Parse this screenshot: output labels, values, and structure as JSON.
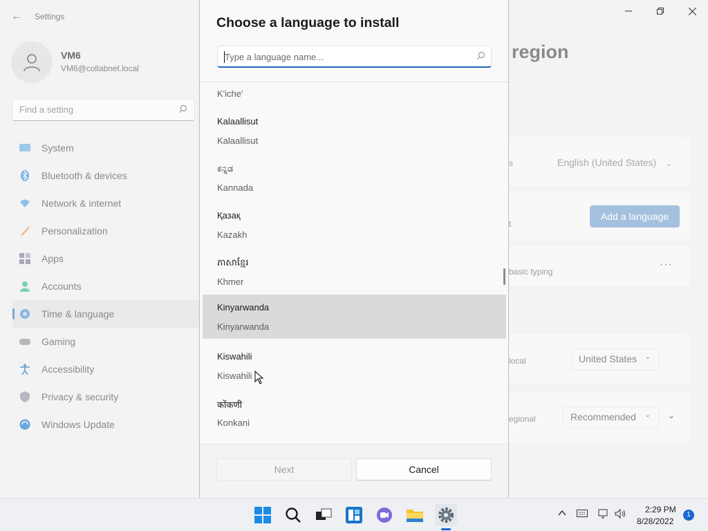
{
  "settings": {
    "title": "Settings",
    "profile": {
      "name": "VM6",
      "email": "VM6@collabnet.local"
    },
    "search_placeholder": "Find a setting",
    "nav": [
      {
        "label": "System",
        "icon": "system-icon"
      },
      {
        "label": "Bluetooth & devices",
        "icon": "bluetooth-icon"
      },
      {
        "label": "Network & internet",
        "icon": "network-icon"
      },
      {
        "label": "Personalization",
        "icon": "brush-icon"
      },
      {
        "label": "Apps",
        "icon": "apps-icon"
      },
      {
        "label": "Accounts",
        "icon": "accounts-icon"
      },
      {
        "label": "Time & language",
        "icon": "globe-clock-icon",
        "active": true
      },
      {
        "label": "Gaming",
        "icon": "gamepad-icon"
      },
      {
        "label": "Accessibility",
        "icon": "accessibility-icon"
      },
      {
        "label": "Privacy & security",
        "icon": "shield-icon"
      },
      {
        "label": "Windows Update",
        "icon": "update-icon"
      }
    ],
    "page_title_fragment": "region",
    "rows": {
      "display_lang_fragment": "s",
      "display_lang_value": "English (United States)",
      "preferred_fragment": "t",
      "add_language": "Add a language",
      "basic_typing": "basic typing",
      "country_fragment": "local",
      "country_value": "United States",
      "format_fragment": "egional",
      "format_value": "Recommended"
    }
  },
  "dialog": {
    "title": "Choose a language to install",
    "search_placeholder": "Type a language name...",
    "languages": [
      {
        "native": "",
        "english": "K'iche'"
      },
      {
        "native": "Kalaallisut",
        "english": "Kalaallisut"
      },
      {
        "native": "ಕನ್ನಡ",
        "english": "Kannada"
      },
      {
        "native": "Қазақ",
        "english": "Kazakh"
      },
      {
        "native": "ភាសាខ្មែរ",
        "english": "Khmer"
      },
      {
        "native": "Kinyarwanda",
        "english": "Kinyarwanda",
        "selected": true
      },
      {
        "native": "Kiswahili",
        "english": "Kiswahili"
      },
      {
        "native": "कोंकणी",
        "english": "Konkani"
      }
    ],
    "next_label": "Next",
    "cancel_label": "Cancel"
  },
  "taskbar": {
    "apps": [
      "windows-start-icon",
      "search-icon",
      "task-view-icon",
      "widgets-icon",
      "chat-icon",
      "file-explorer-icon",
      "settings-gear-icon"
    ],
    "time": "2:29 PM",
    "date": "8/28/2022",
    "notification_count": "1"
  },
  "colors": {
    "accent": "#1967d2",
    "selected_row": "#dadada",
    "add_language_button": "#a3c1df"
  }
}
